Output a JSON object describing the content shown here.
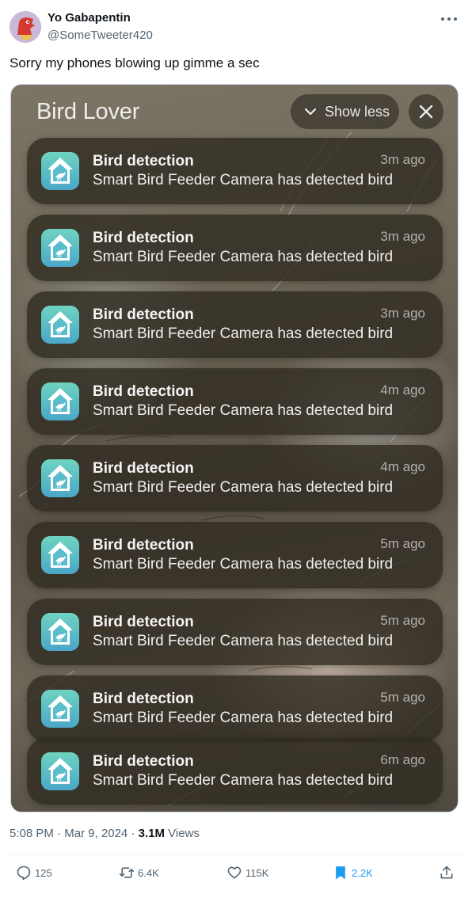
{
  "tweet": {
    "author_name": "Yo Gabapentin",
    "handle": "@SomeTweeter420",
    "text": "Sorry my phones blowing up gimme a sec",
    "time": "5:08 PM",
    "date": "Mar 9, 2024",
    "views_count": "3.1M",
    "views_label": "Views",
    "separator": "·"
  },
  "screenshot": {
    "group_title": "Bird Lover",
    "show_less_label": "Show less",
    "notifications": [
      {
        "title": "Bird detection",
        "body": "Smart Bird Feeder Camera has detected bird",
        "time": "3m ago"
      },
      {
        "title": "Bird detection",
        "body": "Smart Bird Feeder Camera has detected bird",
        "time": "3m ago"
      },
      {
        "title": "Bird detection",
        "body": "Smart Bird Feeder Camera has detected bird",
        "time": "3m ago"
      },
      {
        "title": "Bird detection",
        "body": "Smart Bird Feeder Camera has detected bird",
        "time": "4m ago"
      },
      {
        "title": "Bird detection",
        "body": "Smart Bird Feeder Camera has detected bird",
        "time": "4m ago"
      },
      {
        "title": "Bird detection",
        "body": "Smart Bird Feeder Camera has detected bird",
        "time": "5m ago"
      },
      {
        "title": "Bird detection",
        "body": "Smart Bird Feeder Camera has detected bird",
        "time": "5m ago"
      },
      {
        "title": "Bird detection",
        "body": "Smart Bird Feeder Camera has detected bird",
        "time": "5m ago"
      },
      {
        "title": "Bird detection",
        "body": "Smart Bird Feeder Camera has detected bird",
        "time": "6m ago"
      }
    ]
  },
  "actions": {
    "replies": "125",
    "reposts": "6.4K",
    "likes": "115K",
    "bookmarks": "2.2K"
  },
  "icons": {
    "reply": "reply-icon",
    "repost": "repost-icon",
    "like": "heart-icon",
    "bookmark": "bookmark-icon",
    "share": "share-icon",
    "app": "bird-house-icon"
  },
  "colors": {
    "accent": "#1d9bf0",
    "muted_text": "#536471",
    "app_icon_top": "#6fd3c0",
    "app_icon_bottom": "#4aa7c8"
  }
}
